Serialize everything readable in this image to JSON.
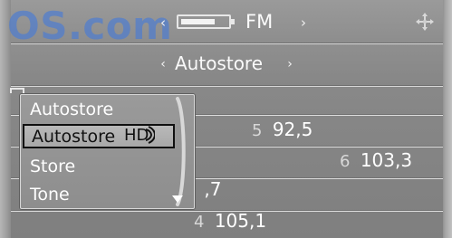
{
  "watermark": {
    "text": "OS.com"
  },
  "header": {
    "title": "FM",
    "battery_level": 0.78
  },
  "subheader": {
    "title": "Autostore"
  },
  "popup": {
    "items": [
      {
        "label": "Autostore"
      },
      {
        "label": "Autostore"
      },
      {
        "label": "Store"
      },
      {
        "label": "Tone"
      }
    ],
    "hd_label": "HD"
  },
  "stations": [
    {
      "number": "5",
      "frequency": "92,5"
    },
    {
      "number": "6",
      "frequency": "103,3"
    },
    {
      "number": "",
      "frequency": ",7"
    },
    {
      "number": "4",
      "frequency": "105,1"
    }
  ],
  "icons": {
    "top_left": "left-arrow-icon",
    "top_right": "right-arrow-icon",
    "sub_left": "left-arrow-icon",
    "sub_right": "right-arrow-icon",
    "corner": "compass-icon",
    "battery": "battery-icon",
    "scroll": "scroll-down-icon"
  }
}
